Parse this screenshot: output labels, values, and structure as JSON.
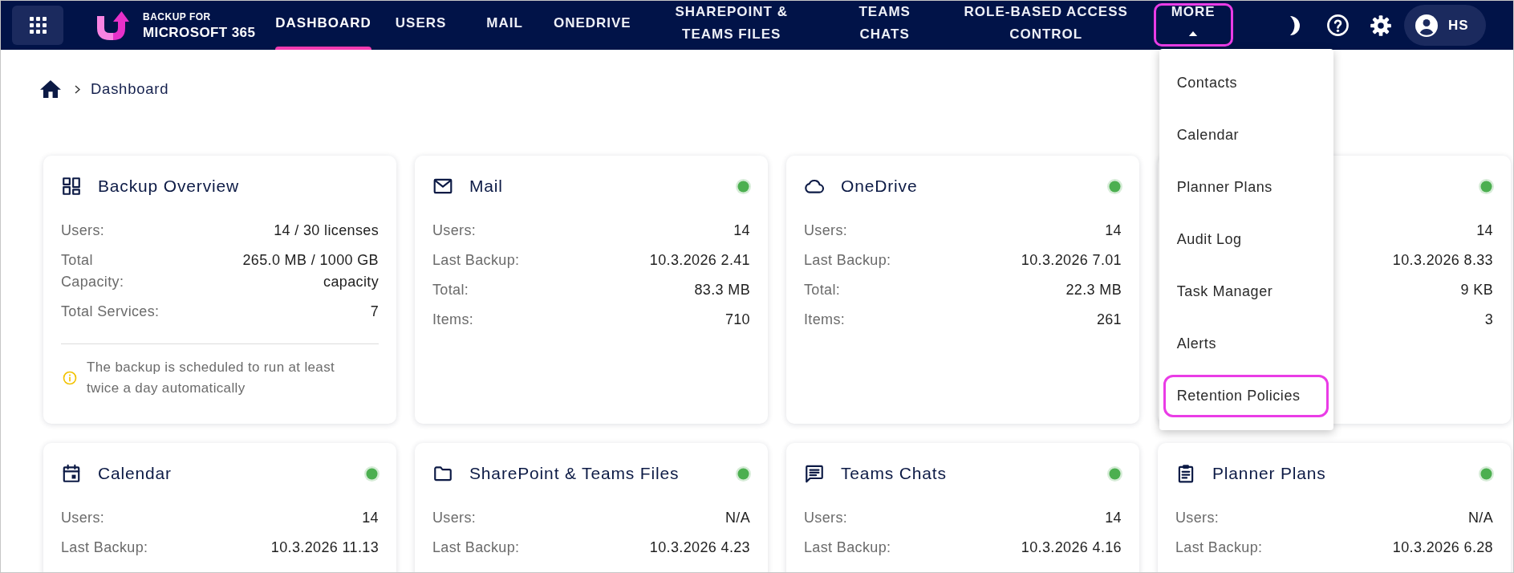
{
  "navbar": {
    "brand": {
      "lines": [
        "BACKUP FOR",
        "MICROSOFT 365"
      ]
    },
    "items": [
      {
        "kind": "link",
        "label": "DASHBOARD",
        "selected": true,
        "highlighted": false
      },
      {
        "kind": "link",
        "label": "USERS",
        "selected": false,
        "highlighted": false
      },
      {
        "kind": "link",
        "label": "MAIL",
        "selected": false,
        "highlighted": false
      },
      {
        "kind": "link",
        "label": "ONEDRIVE",
        "selected": false,
        "highlighted": false
      },
      {
        "kind": "link",
        "label": "SHAREPOINT & TEAMS FILES",
        "selected": false,
        "highlighted": false
      },
      {
        "kind": "link",
        "label": "TEAMS CHATS",
        "selected": false,
        "highlighted": false
      },
      {
        "kind": "link",
        "label": "ROLE-BASED ACCESS CONTROL",
        "selected": false,
        "highlighted": false
      },
      {
        "kind": "menu",
        "label": "MORE",
        "selected": false,
        "highlighted": true,
        "expanded": true,
        "menu": [
          {
            "label": "Contacts",
            "highlighted": false
          },
          {
            "label": "Calendar",
            "highlighted": false
          },
          {
            "label": "Planner Plans",
            "highlighted": false
          },
          {
            "label": "Audit Log",
            "highlighted": false
          },
          {
            "label": "Task Manager",
            "highlighted": false
          },
          {
            "label": "Alerts",
            "highlighted": false
          },
          {
            "label": "Retention Policies",
            "highlighted": true
          }
        ]
      }
    ],
    "user": {
      "initials": "HS"
    }
  },
  "breadcrumb": [
    {
      "label": "Dashboard"
    }
  ],
  "cards": [
    {
      "kind": "overview",
      "title": "Backup Overview",
      "rows": [
        {
          "label": "Users:",
          "value": "14 / 30 licenses"
        },
        {
          "label": "Total Capacity:",
          "value": "265.0 MB / 1000 GB capacity"
        },
        {
          "label": "Total Services:",
          "value": "7"
        }
      ],
      "note": "The backup is scheduled to run at least twice a day automatically"
    },
    {
      "kind": "mail",
      "title": "Mail",
      "healthy": true,
      "rows": [
        {
          "label": "Users:",
          "value": "14"
        },
        {
          "label": "Last Backup:",
          "value": "10.3.2026 2.41"
        },
        {
          "label": "Total:",
          "value": "83.3 MB"
        },
        {
          "label": "Items:",
          "value": "710"
        }
      ]
    },
    {
      "kind": "onedrive",
      "title": "OneDrive",
      "healthy": true,
      "rows": [
        {
          "label": "Users:",
          "value": "14"
        },
        {
          "label": "Last Backup:",
          "value": "10.3.2026 7.01"
        },
        {
          "label": "Total:",
          "value": "22.3 MB"
        },
        {
          "label": "Items:",
          "value": "261"
        }
      ]
    },
    {
      "healthy": true,
      "rows": [
        {
          "value": "14"
        },
        {
          "value": "10.3.2026 8.33"
        },
        {
          "value": "9 KB"
        },
        {
          "value": "3"
        }
      ]
    },
    {
      "kind": "calendar",
      "title": "Calendar",
      "healthy": true,
      "rows": [
        {
          "label": "Users:",
          "value": "14"
        },
        {
          "label": "Last Backup:",
          "value": "10.3.2026 11.13"
        }
      ]
    },
    {
      "kind": "sharepoint",
      "title": "SharePoint & Teams Files",
      "healthy": true,
      "rows": [
        {
          "label": "Users:",
          "value": "N/A"
        },
        {
          "label": "Last Backup:",
          "value": "10.3.2026 4.23"
        }
      ]
    },
    {
      "kind": "chats",
      "title": "Teams Chats",
      "healthy": true,
      "rows": [
        {
          "label": "Users:",
          "value": "14"
        },
        {
          "label": "Last Backup:",
          "value": "10.3.2026 4.16"
        }
      ]
    },
    {
      "kind": "planner",
      "title": "Planner Plans",
      "healthy": true,
      "rows": [
        {
          "label": "Users:",
          "value": "N/A"
        },
        {
          "label": "Last Backup:",
          "value": "10.3.2026 6.28"
        }
      ]
    }
  ]
}
